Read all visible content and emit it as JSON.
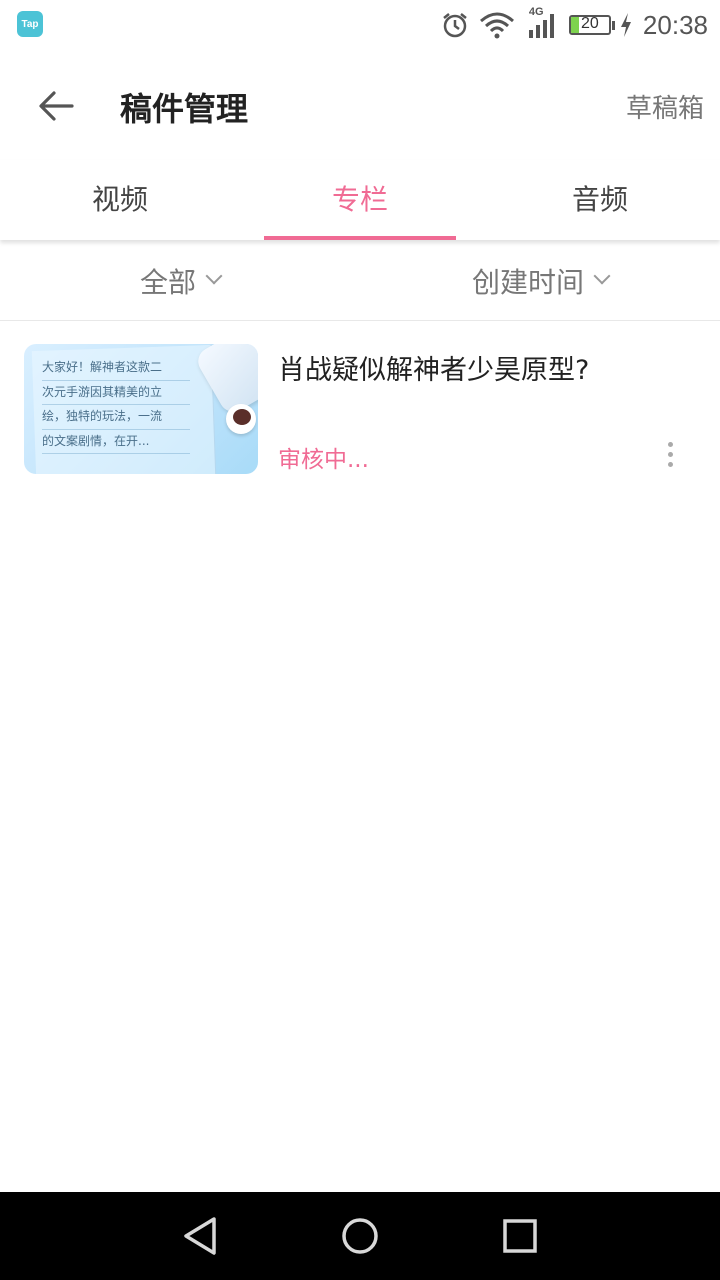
{
  "status_bar": {
    "app_icon_label": "Tap",
    "network": "4G",
    "battery_level": "20",
    "battery_fraction": 0.2,
    "time": "20:38",
    "icons": [
      "alarm-icon",
      "wifi-icon",
      "signal-icon",
      "battery-icon",
      "charging-icon"
    ]
  },
  "header": {
    "title": "稿件管理",
    "drafts_label": "草稿箱",
    "back_icon": "back-arrow-icon"
  },
  "tabs": [
    {
      "label": "视频",
      "active": false
    },
    {
      "label": "专栏",
      "active": true
    },
    {
      "label": "音频",
      "active": false
    }
  ],
  "filters": {
    "category": "全部",
    "sort": "创建时间"
  },
  "items": [
    {
      "title": "肖战疑似解神者少昊原型?",
      "status": "审核中...",
      "thumbnail_lines": [
        "大家好！解神者这款二",
        "次元手游因其精美的立",
        "绘，独特的玩法，一流",
        "的文案剧情，在开..."
      ]
    }
  ],
  "colors": {
    "accent": "#f06b94",
    "tap_icon": "#4cc3d6",
    "battery_fill": "#7ed34f"
  },
  "nav_icons": [
    "nav-back-icon",
    "nav-home-icon",
    "nav-recents-icon"
  ]
}
